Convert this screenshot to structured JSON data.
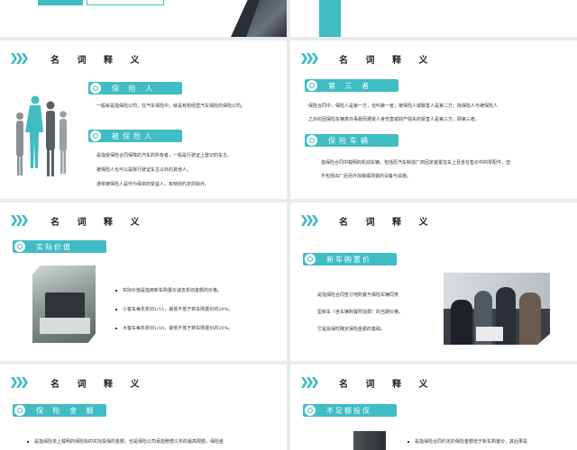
{
  "section_title": "名 词 释 义",
  "slide2": {
    "term1": "保 险 人",
    "term1_desc": "一般就是指保险公司，在汽车保险中，就是有权经营汽车保险的保险公司。",
    "term2": "被保险人",
    "term2_lines": [
      "是指受保险合同保障的汽车的所有者，一般是行驶证上登记的车主。",
      "被保险人也可以是除行驶证车主以外的其他人。",
      "通常被保险人是作为保单的受益人，有特别约定的除外。"
    ]
  },
  "slide3": {
    "term1": "第 三 者",
    "term1_lines": [
      "保险合同中，保险人是第一方，也叫第一者；被保险人或致害人是第二方；除保险人与被保险人",
      "之外的因保险车辆意外事故而遭受人身伤害或财产损失的受害人是第三方，即第三者。"
    ],
    "term2": "保险车辆",
    "term2_lines": [
      "指保险合同中载明的机动车辆，包括原汽车制造厂商固定装置在车上且含在售价中的零配件，但",
      "不包括出厂后另外加装或改装的设备与设施。"
    ]
  },
  "slide4": {
    "term": "实际价值",
    "bullets": [
      "实际价值是指用新车购置价减去折旧金额的价格。",
      "小客车每年折旧1/15，最低不低于新车购置价的20%。",
      "大客车每年折旧1/10，最低不低于新车购置价的20%。"
    ]
  },
  "slide5": {
    "term": "新车购置价",
    "lines": [
      "是指保险合同签订地购置与保险车辆同类",
      "型新车（含车辆购置附加费）的当期价格。",
      "它是投保时确定保险金额的基础。"
    ]
  },
  "slide6": {
    "term": "保 险 金 额",
    "bullet": "是指保险单上载明的保险标的实际投保的金额，也是保险公司承担赔偿义务的最高限额，保险金"
  },
  "slide7": {
    "term": "不足额投保",
    "bullet": "是指保险合同约定的保险金额低于新车购置价，其后果是"
  },
  "colors": {
    "accent": "#3fbcc4",
    "text": "#333333",
    "background": "#ffffff"
  }
}
